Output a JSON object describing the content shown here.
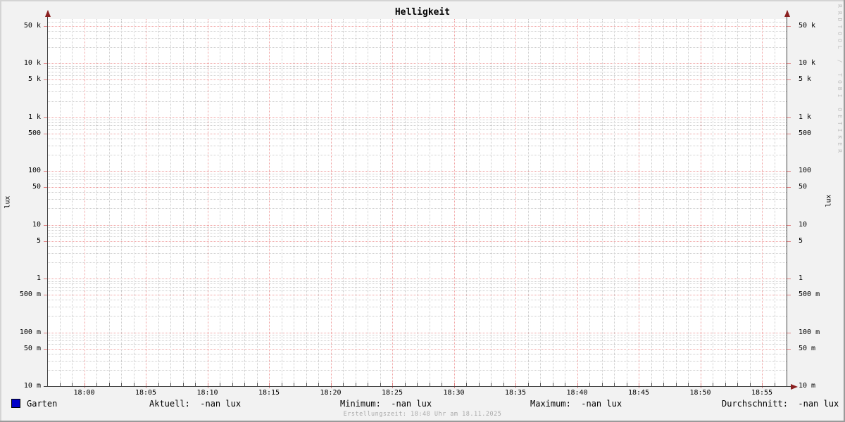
{
  "watermark": "RRDTOOL / TOBI OETIKER",
  "footer": "Erstellungszeit: 18:48 Uhr am 18.11.2025",
  "chart_data": {
    "type": "line",
    "title": "Helligkeit",
    "ylabel_left": "lux",
    "ylabel_right": "lux",
    "y_scale": "log",
    "y_min": 0.01,
    "y_max": 66700,
    "x_range": [
      "17:57",
      "18:57"
    ],
    "x_minutes_total": 60,
    "x_minor_step_minutes": 1,
    "x_ticks_major": [
      {
        "label": "18:00",
        "minute": 3
      },
      {
        "label": "18:05",
        "minute": 8
      },
      {
        "label": "18:10",
        "minute": 13
      },
      {
        "label": "18:15",
        "minute": 18
      },
      {
        "label": "18:20",
        "minute": 23
      },
      {
        "label": "18:25",
        "minute": 28
      },
      {
        "label": "18:30",
        "minute": 33
      },
      {
        "label": "18:35",
        "minute": 38
      },
      {
        "label": "18:40",
        "minute": 43
      },
      {
        "label": "18:45",
        "minute": 48
      },
      {
        "label": "18:50",
        "minute": 53
      },
      {
        "label": "18:55",
        "minute": 58
      }
    ],
    "y_ticks_major": [
      {
        "label": "50 k",
        "value": 50000
      },
      {
        "label": "10 k",
        "value": 10000
      },
      {
        "label": "5 k",
        "value": 5000
      },
      {
        "label": "1 k",
        "value": 1000
      },
      {
        "label": "500",
        "value": 500
      },
      {
        "label": "100",
        "value": 100
      },
      {
        "label": "50",
        "value": 50
      },
      {
        "label": "10",
        "value": 10
      },
      {
        "label": "5",
        "value": 5
      },
      {
        "label": "1",
        "value": 1
      },
      {
        "label": "500 m",
        "value": 0.5
      },
      {
        "label": "100 m",
        "value": 0.1
      },
      {
        "label": "50 m",
        "value": 0.05
      },
      {
        "label": "10 m",
        "value": 0.01
      }
    ],
    "grid": true,
    "legend_position": "bottom",
    "series": [
      {
        "name": "Garten",
        "color": "#0000c8",
        "values": []
      }
    ],
    "stats": [
      {
        "label": "Aktuell:",
        "value": "-nan lux"
      },
      {
        "label": "Minimum:",
        "value": "-nan lux"
      },
      {
        "label": "Maximum:",
        "value": "-nan lux"
      },
      {
        "label": "Durchschnitt:",
        "value": "-nan lux"
      }
    ]
  },
  "colors": {
    "background": "#f2f2f2",
    "canvas": "#ffffff",
    "grid_minor": "#cdcdcd",
    "grid_major": "#f0a0a0",
    "tick_minor": "#555555",
    "tick_major": "#e08080",
    "axis": "#444444",
    "arrow": "#8b2020",
    "bevel_light": "#d4d4d4",
    "bevel_dark": "#9a9a9a",
    "muted_text": "#a9a9a9",
    "watermark": "#c0c0c0"
  }
}
